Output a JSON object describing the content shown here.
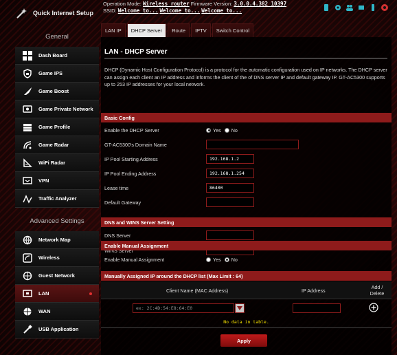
{
  "header": {
    "quick_setup": "Quick Internet Setup",
    "operation_mode_label": "Operation Mode:",
    "operation_mode_value": "Wireless router",
    "firmware_label": "Firmware Version:",
    "firmware_value": "3.0.0.4.382_10397",
    "ssid_label": "SSID:",
    "ssid_values": [
      "Welcome to...",
      "Welcome to...",
      "Welcome to..."
    ]
  },
  "sidebar": {
    "general_title": "General",
    "general_items": [
      {
        "label": "Dash Board",
        "icon": "dashboard-icon"
      },
      {
        "label": "Game IPS",
        "icon": "shield-lock-icon"
      },
      {
        "label": "Game Boost",
        "icon": "rocket-icon"
      },
      {
        "label": "Game Private Network",
        "icon": "monitor-icon"
      },
      {
        "label": "Game Profile",
        "icon": "profile-icon"
      },
      {
        "label": "Game Radar",
        "icon": "radar-icon"
      },
      {
        "label": "WiFi Radar",
        "icon": "wifi-radar-icon"
      },
      {
        "label": "VPN",
        "icon": "vpn-icon"
      },
      {
        "label": "Traffic Analyzer",
        "icon": "traffic-icon"
      }
    ],
    "advanced_title": "Advanced Settings",
    "advanced_items": [
      {
        "label": "Network Map",
        "icon": "globe-icon"
      },
      {
        "label": "Wireless",
        "icon": "wireless-icon"
      },
      {
        "label": "Guest Network",
        "icon": "guest-globe-icon"
      },
      {
        "label": "LAN",
        "icon": "lan-icon",
        "active": true
      },
      {
        "label": "WAN",
        "icon": "wan-globe-icon"
      },
      {
        "label": "USB Application",
        "icon": "usb-icon"
      }
    ]
  },
  "tabs": [
    "LAN IP",
    "DHCP Server",
    "Route",
    "IPTV",
    "Switch Control"
  ],
  "active_tab": "DHCP Server",
  "page": {
    "title": "LAN - DHCP Server",
    "description": "DHCP (Dynamic Host Configuration Protocol) is a protocol for the automatic configuration used on IP networks. The DHCP server can assign each client an IP address and informs the client of the of DNS server IP and default gateway IP. GT-AC5300 supports up to 253 IP addresses for your local network."
  },
  "basic_config": {
    "heading": "Basic Config",
    "enable_label": "Enable the DHCP Server",
    "yes": "Yes",
    "no": "No",
    "enable_value": "Yes",
    "domain_label": "GT-AC5300's Domain Name",
    "domain_value": "",
    "start_label": "IP Pool Starting Address",
    "start_value": "192.168.1.2",
    "end_label": "IP Pool Ending Address",
    "end_value": "192.168.1.254",
    "lease_label": "Lease time",
    "lease_value": "86400",
    "gateway_label": "Default Gateway",
    "gateway_value": ""
  },
  "dns_wins": {
    "heading": "DNS and WINS Server Setting",
    "dns_label": "DNS Server",
    "dns_value": "",
    "wins_label": "WINS Server",
    "wins_value": ""
  },
  "manual": {
    "heading": "Enable Manual Assignment",
    "label": "Enable Manual Assignment",
    "yes": "Yes",
    "no": "No",
    "value": "No"
  },
  "list": {
    "heading": "Manually Assigned IP around the DHCP list (Max Limit : 64)",
    "col_client": "Client Name (MAC Address)",
    "col_ip": "IP Address",
    "col_add": "Add / Delete",
    "mac_placeholder": "ex: 2C:4D:54:E8:64:E0",
    "ip_placeholder": "",
    "empty_text": "No data in table."
  },
  "apply_label": "Apply",
  "colors": {
    "accent": "#8e1b1b",
    "nodata": "#f6e200"
  }
}
